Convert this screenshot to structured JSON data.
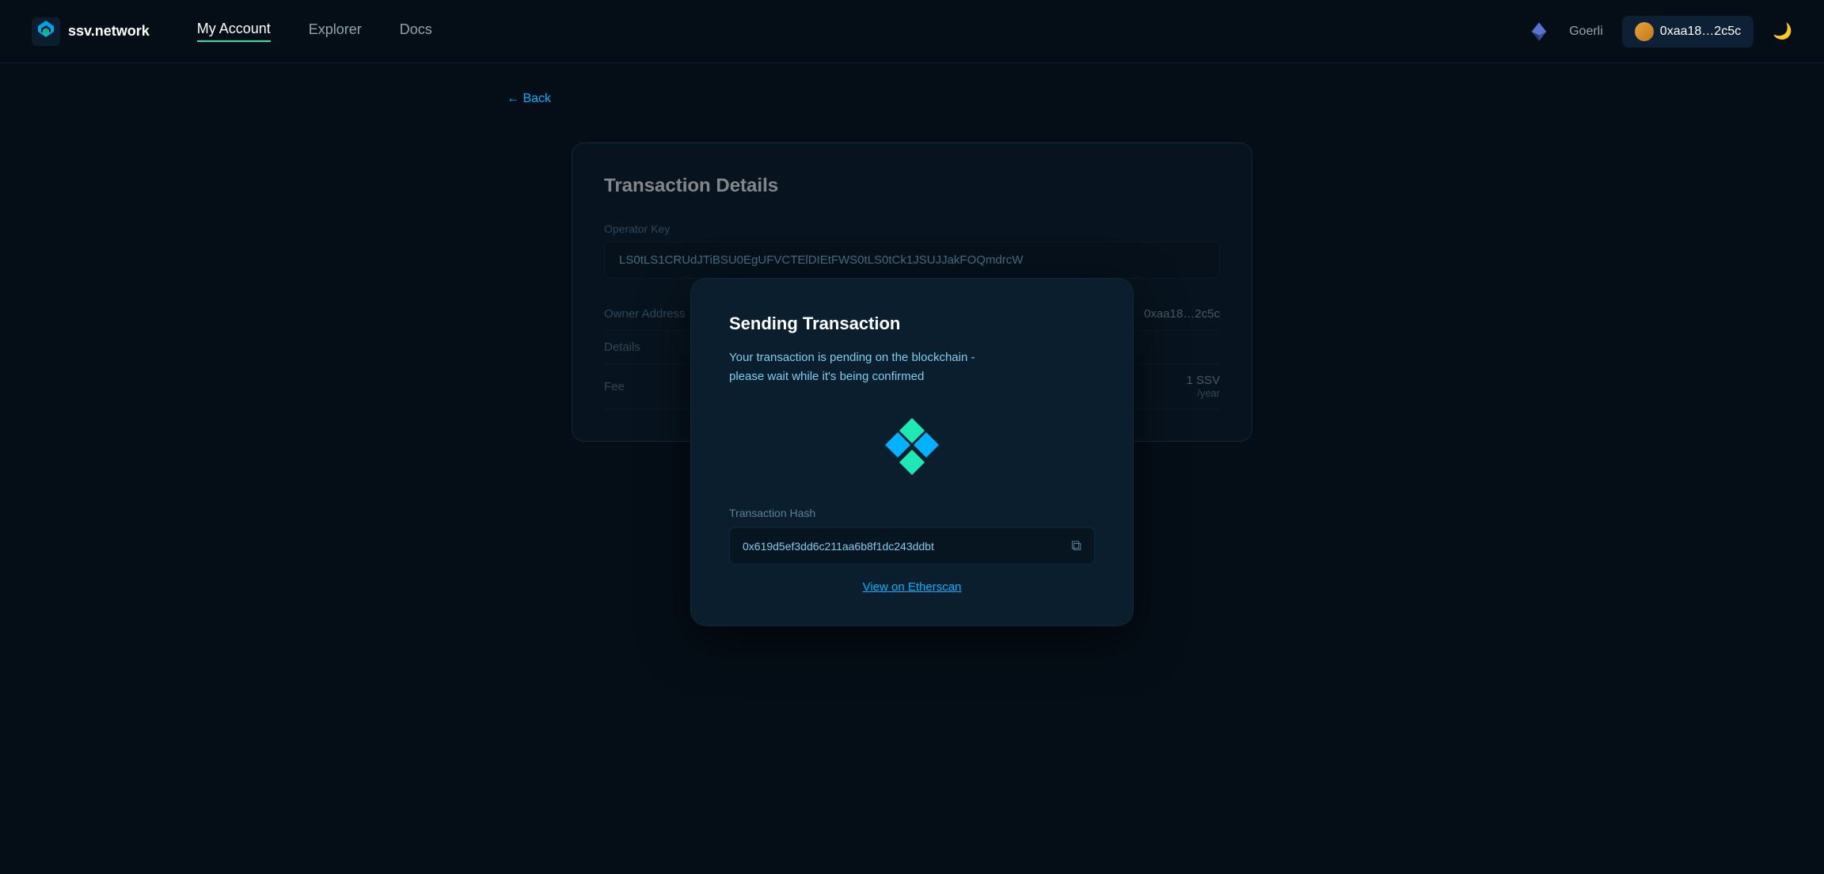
{
  "navbar": {
    "logo_text": "ssv.network",
    "links": [
      {
        "label": "My Account",
        "active": true
      },
      {
        "label": "Explorer",
        "active": false
      },
      {
        "label": "Docs",
        "active": false
      }
    ],
    "network": "Goerli",
    "wallet_address": "0xaa18…2c5c",
    "theme_icon": "🌙"
  },
  "back_link": "← Back",
  "transaction_details": {
    "title": "Transaction Details",
    "operator_key_label": "Operator Key",
    "operator_key_value": "LS0tLS1CRUdJTiBSU0EgUFVCTElDIEtFWS0tLS0tCk1JSUJJakFOQmdrcW",
    "owner_address_label": "Owner Address",
    "owner_address_value": "0xaa18…2c5c",
    "details_label": "Details",
    "fee_label": "Fee",
    "fee_value": "1 SSV",
    "fee_unit": "/year"
  },
  "modal": {
    "title": "Sending Transaction",
    "description": "Your transaction is pending on the blockchain -\nplease wait while it's being confirmed",
    "hash_label": "Transaction Hash",
    "hash_value": "0x619d5ef3dd6c211aa6b8f1dc243ddbt",
    "etherscan_link": "View on Etherscan"
  }
}
